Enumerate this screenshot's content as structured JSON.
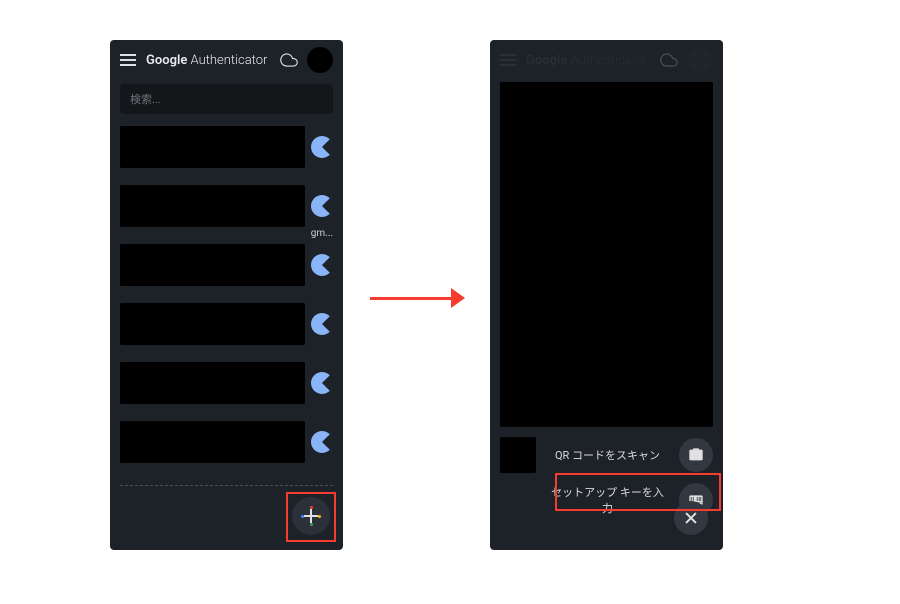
{
  "appTitle": {
    "bold": "Google",
    "light": " Authenticator"
  },
  "searchPlaceholder": "検索...",
  "items": [
    {
      "label": ""
    },
    {
      "label": ""
    },
    {
      "label": "gm..."
    },
    {
      "label": ""
    },
    {
      "label": ""
    },
    {
      "label": ""
    }
  ],
  "options": {
    "scanQr": "QR コードをスキャン",
    "setupKey": "セットアップ キーを入力"
  }
}
